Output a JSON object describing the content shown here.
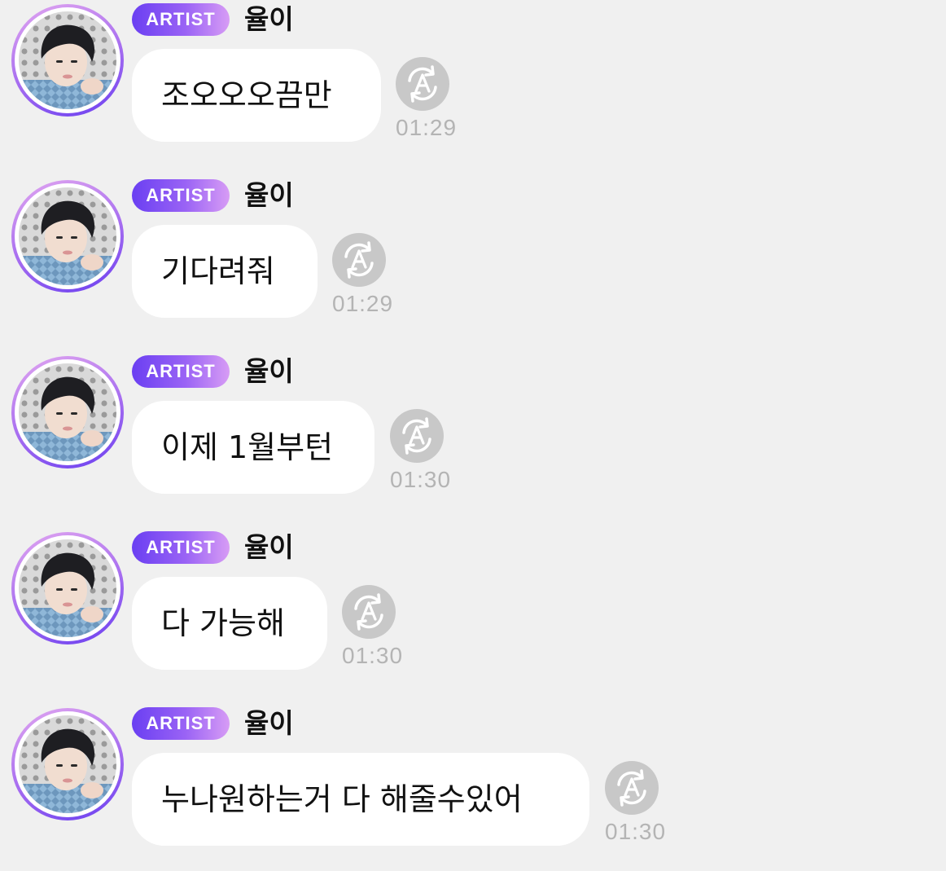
{
  "messages": [
    {
      "badge": "ARTIST",
      "sender": "율이",
      "text": "조오오오끔만",
      "time": "01:29"
    },
    {
      "badge": "ARTIST",
      "sender": "율이",
      "text": "기다려줘",
      "time": "01:29"
    },
    {
      "badge": "ARTIST",
      "sender": "율이",
      "text": "이제 1월부턴",
      "time": "01:30"
    },
    {
      "badge": "ARTIST",
      "sender": "율이",
      "text": "다 가능해",
      "time": "01:30"
    },
    {
      "badge": "ARTIST",
      "sender": "율이",
      "text": "누나원하는거 다 해줄수있어",
      "time": "01:30"
    }
  ],
  "icons": {
    "avatar": "avatar-photo",
    "translate": "translate-icon"
  },
  "colors": {
    "background": "#f0f0f0",
    "bubble": "#ffffff",
    "badge_start": "#6a3ff2",
    "badge_end": "#d79cf5",
    "timestamp": "#b4b4b4",
    "translate_icon": "#c8c8c8"
  }
}
